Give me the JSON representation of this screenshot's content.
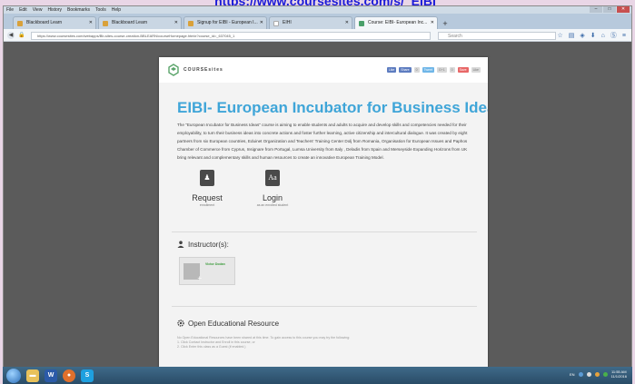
{
  "slide_link": "https://www.coursesites.com/s/_EIBI",
  "menu": [
    "File",
    "Edit",
    "View",
    "History",
    "Bookmarks",
    "Tools",
    "Help"
  ],
  "tabs": [
    {
      "label": "Blackboard Learn",
      "active": false
    },
    {
      "label": "Blackboard Learn",
      "active": false
    },
    {
      "label": "Signup for EIBI - European I...",
      "active": false
    },
    {
      "label": "EIHI",
      "active": false
    },
    {
      "label": "Course: EIBI- European Inc...",
      "active": true
    }
  ],
  "url": "https://www.coursesites.com/webapps/Bb-sites-course-creation-BBLEARN/courseHomepage.htmlx?course_id=_637045_1",
  "search_placeholder": "Search",
  "logo_text": "COURSEsites",
  "share": {
    "fb_like": "Like",
    "share": "Share",
    "count1": "0",
    "tweet": "Tweet",
    "g1": "G+1",
    "count2": "0",
    "pin": "Save",
    "like": "Like"
  },
  "course": {
    "title": "EIBI- European Incubator for Business Ideas",
    "description": "The \"European Incubator for Business Ideas\" course is aiming to enable students and adults to acquire and develop skills and competencies needed for their employability, to turn their business ideas into concrete actions and foster further learning, active citizenship and intercultural dialogue. It was created by eight partners from six European countries, Eduinet Organization and Teachers' Training Center Dolj from Romania, Organisation for European Issues and Paphos Chamber of Commerce from Cyprus, Insignare from Portugal, Lumsa University from Italy , Deladis from Spain and Merseyside Expanding Horizons from UK bring relevant and complementary skills and human resources to create an innovative European Training Model."
  },
  "actions": [
    {
      "title": "Request",
      "subtitle": "enrollment",
      "icon": "request-icon"
    },
    {
      "title": "Login",
      "subtitle": "as an enrolled student",
      "icon": "login-icon"
    }
  ],
  "instructors": {
    "heading": "Instructor(s):",
    "name": "Victor Dodan"
  },
  "oer": {
    "heading": "Open Educational Resource",
    "text": "No Open Educational Resources have been shared at this time. To gain access to this course you may try the following:\n1. Click Contact Instructor and Enroll in this course, or\n2. Click Enter this class as a Guest (if enabled.)"
  },
  "taskbar": {
    "lang": "EN",
    "time": "11:55 AM",
    "date": "11/1/2016"
  },
  "colors": {
    "title_blue": "#3fa5d8",
    "instructor_green": "#3a9b3a"
  }
}
